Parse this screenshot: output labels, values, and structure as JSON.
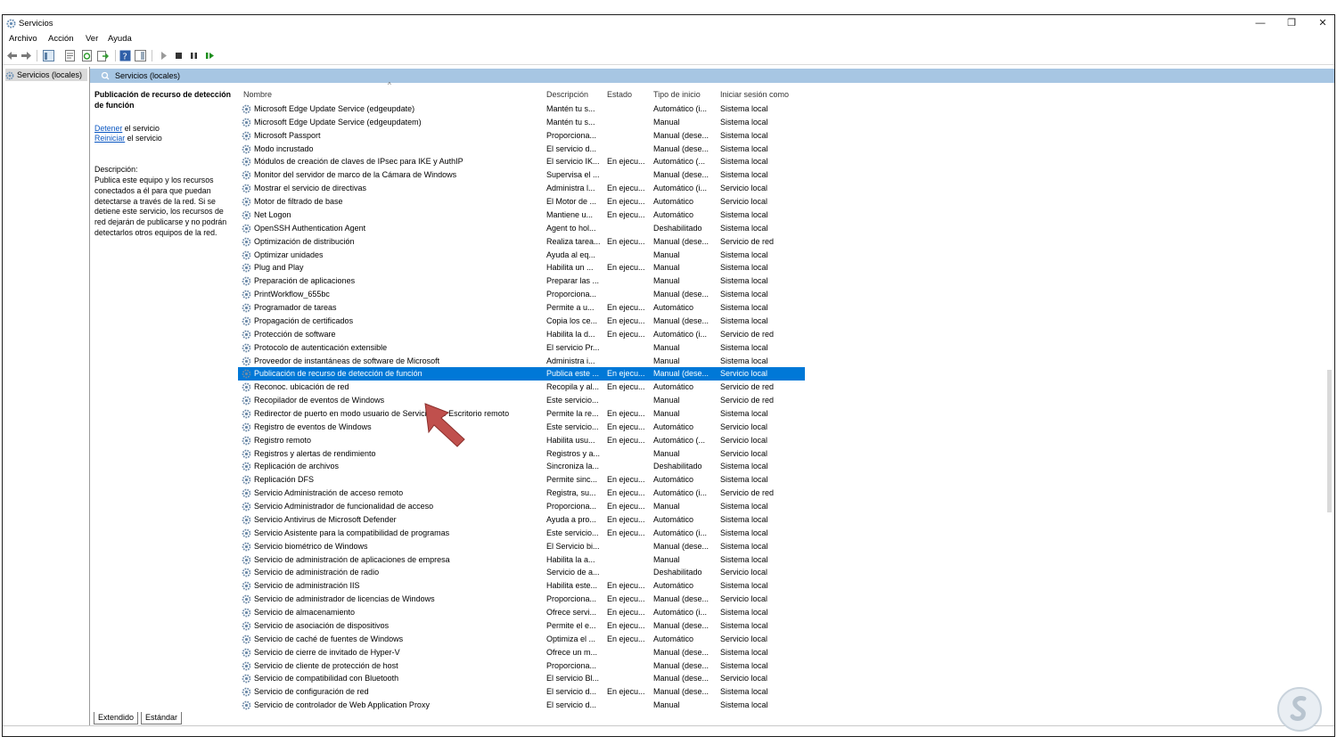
{
  "window": {
    "title": "Servicios",
    "minimize": "—",
    "restore": "❐",
    "close": "✕"
  },
  "menu": [
    "Archivo",
    "Acción",
    "Ver",
    "Ayuda"
  ],
  "toolbar": [
    "back-icon",
    "forward-icon",
    "show-console-tree-icon",
    "properties-icon",
    "refresh-icon",
    "export-list-icon",
    "help-icon",
    "show-action-pane-icon",
    "start-service-icon",
    "stop-service-icon",
    "pause-service-icon",
    "resume-service-icon"
  ],
  "tree": {
    "label": "Servicios (locales)"
  },
  "pane": {
    "header": "Servicios (locales)"
  },
  "details": {
    "name": "Publicación de recurso de detección de función",
    "stop_link": "Detener",
    "stop_rest": " el servicio",
    "restart_link": "Reiniciar",
    "restart_rest": " el servicio",
    "desc_label": "Descripción:",
    "desc_text": "Publica este equipo y los recursos conectados a él para que puedan detectarse a través de la red. Si se detiene este servicio, los recursos de red dejarán de publicarse y no podrán detectarlos otros equipos de la red."
  },
  "columns": [
    "Nombre",
    "Descripción",
    "Estado",
    "Tipo de inicio",
    "Iniciar sesión como"
  ],
  "services": [
    [
      "Microsoft Edge Update Service (edgeupdate)",
      "Mantén tu s...",
      "",
      "Automático (i...",
      "Sistema local"
    ],
    [
      "Microsoft Edge Update Service (edgeupdatem)",
      "Mantén tu s...",
      "",
      "Manual",
      "Sistema local"
    ],
    [
      "Microsoft Passport",
      "Proporciona...",
      "",
      "Manual (dese...",
      "Sistema local"
    ],
    [
      "Modo incrustado",
      "El servicio d...",
      "",
      "Manual (dese...",
      "Sistema local"
    ],
    [
      "Módulos de creación de claves de IPsec para IKE y AuthIP",
      "El servicio IK...",
      "En ejecu...",
      "Automático (...",
      "Sistema local"
    ],
    [
      "Monitor del servidor de marco de la Cámara de Windows",
      "Supervisa el ...",
      "",
      "Manual (dese...",
      "Sistema local"
    ],
    [
      "Mostrar el servicio de directivas",
      "Administra l...",
      "En ejecu...",
      "Automático (i...",
      "Servicio local"
    ],
    [
      "Motor de filtrado de base",
      "El Motor de ...",
      "En ejecu...",
      "Automático",
      "Servicio local"
    ],
    [
      "Net Logon",
      "Mantiene u...",
      "En ejecu...",
      "Automático",
      "Sistema local"
    ],
    [
      "OpenSSH Authentication Agent",
      "Agent to hol...",
      "",
      "Deshabilitado",
      "Sistema local"
    ],
    [
      "Optimización de distribución",
      "Realiza tarea...",
      "En ejecu...",
      "Manual (dese...",
      "Servicio de red"
    ],
    [
      "Optimizar unidades",
      "Ayuda al eq...",
      "",
      "Manual",
      "Sistema local"
    ],
    [
      "Plug and Play",
      "Habilita un ...",
      "En ejecu...",
      "Manual",
      "Sistema local"
    ],
    [
      "Preparación de aplicaciones",
      "Preparar las ...",
      "",
      "Manual",
      "Sistema local"
    ],
    [
      "PrintWorkflow_655bc",
      "Proporciona...",
      "",
      "Manual (dese...",
      "Sistema local"
    ],
    [
      "Programador de tareas",
      "Permite a u...",
      "En ejecu...",
      "Automático",
      "Sistema local"
    ],
    [
      "Propagación de certificados",
      "Copia los ce...",
      "En ejecu...",
      "Manual (dese...",
      "Sistema local"
    ],
    [
      "Protección de software",
      "Habilita la d...",
      "En ejecu...",
      "Automático (i...",
      "Servicio de red"
    ],
    [
      "Protocolo de autenticación extensible",
      "El servicio Pr...",
      "",
      "Manual",
      "Sistema local"
    ],
    [
      "Proveedor de instantáneas de software de Microsoft",
      "Administra i...",
      "",
      "Manual",
      "Sistema local"
    ],
    [
      "Publicación de recurso de detección de función",
      "Publica este ...",
      "En ejecu...",
      "Manual (dese...",
      "Servicio local"
    ],
    [
      "Reconoc. ubicación de red",
      "Recopila y al...",
      "En ejecu...",
      "Automático",
      "Servicio de red"
    ],
    [
      "Recopilador de eventos de Windows",
      "Este servicio...",
      "",
      "Manual",
      "Servicio de red"
    ],
    [
      "Redirector de puerto en modo usuario de Servicios de Escritorio remoto",
      "Permite la re...",
      "En ejecu...",
      "Manual",
      "Sistema local"
    ],
    [
      "Registro de eventos de Windows",
      "Este servicio...",
      "En ejecu...",
      "Automático",
      "Servicio local"
    ],
    [
      "Registro remoto",
      "Habilita usu...",
      "En ejecu...",
      "Automático (...",
      "Servicio local"
    ],
    [
      "Registros y alertas de rendimiento",
      "Registros y a...",
      "",
      "Manual",
      "Servicio local"
    ],
    [
      "Replicación de archivos",
      "Sincroniza la...",
      "",
      "Deshabilitado",
      "Sistema local"
    ],
    [
      "Replicación DFS",
      "Permite sinc...",
      "En ejecu...",
      "Automático",
      "Sistema local"
    ],
    [
      "Servicio Administración de acceso remoto",
      "Registra, su...",
      "En ejecu...",
      "Automático (i...",
      "Servicio de red"
    ],
    [
      "Servicio Administrador de funcionalidad de acceso",
      "Proporciona...",
      "En ejecu...",
      "Manual",
      "Sistema local"
    ],
    [
      "Servicio Antivirus de Microsoft Defender",
      "Ayuda a pro...",
      "En ejecu...",
      "Automático",
      "Sistema local"
    ],
    [
      "Servicio Asistente para la compatibilidad de programas",
      "Este servicio...",
      "En ejecu...",
      "Automático (i...",
      "Sistema local"
    ],
    [
      "Servicio biométrico de Windows",
      "El Servicio bi...",
      "",
      "Manual (dese...",
      "Sistema local"
    ],
    [
      "Servicio de administración de aplicaciones de empresa",
      "Habilita la a...",
      "",
      "Manual",
      "Sistema local"
    ],
    [
      "Servicio de administración de radio",
      "Servicio de a...",
      "",
      "Deshabilitado",
      "Servicio local"
    ],
    [
      "Servicio de administración IIS",
      "Habilita este...",
      "En ejecu...",
      "Automático",
      "Sistema local"
    ],
    [
      "Servicio de administrador de licencias de Windows",
      "Proporciona...",
      "En ejecu...",
      "Manual (dese...",
      "Servicio local"
    ],
    [
      "Servicio de almacenamiento",
      "Ofrece servi...",
      "En ejecu...",
      "Automático (i...",
      "Sistema local"
    ],
    [
      "Servicio de asociación de dispositivos",
      "Permite el e...",
      "En ejecu...",
      "Manual (dese...",
      "Sistema local"
    ],
    [
      "Servicio de caché de fuentes de Windows",
      "Optimiza el ...",
      "En ejecu...",
      "Automático",
      "Servicio local"
    ],
    [
      "Servicio de cierre de invitado de Hyper-V",
      "Ofrece un m...",
      "",
      "Manual (dese...",
      "Sistema local"
    ],
    [
      "Servicio de cliente de protección de host",
      "Proporciona...",
      "",
      "Manual (dese...",
      "Sistema local"
    ],
    [
      "Servicio de compatibilidad con Bluetooth",
      "El servicio Bl...",
      "",
      "Manual (dese...",
      "Servicio local"
    ],
    [
      "Servicio de configuración de red",
      "El servicio d...",
      "En ejecu...",
      "Manual (dese...",
      "Sistema local"
    ],
    [
      "Servicio de controlador de Web Application Proxy",
      "El servicio d...",
      "",
      "Manual",
      "Sistema local"
    ]
  ],
  "selected_index": 20,
  "tabs": [
    "Extendido",
    "Estándar"
  ],
  "colors": {
    "selection": "#0078d7",
    "header": "#a7c6e3",
    "arrow": "#c0504d",
    "link": "#0b57c2"
  }
}
